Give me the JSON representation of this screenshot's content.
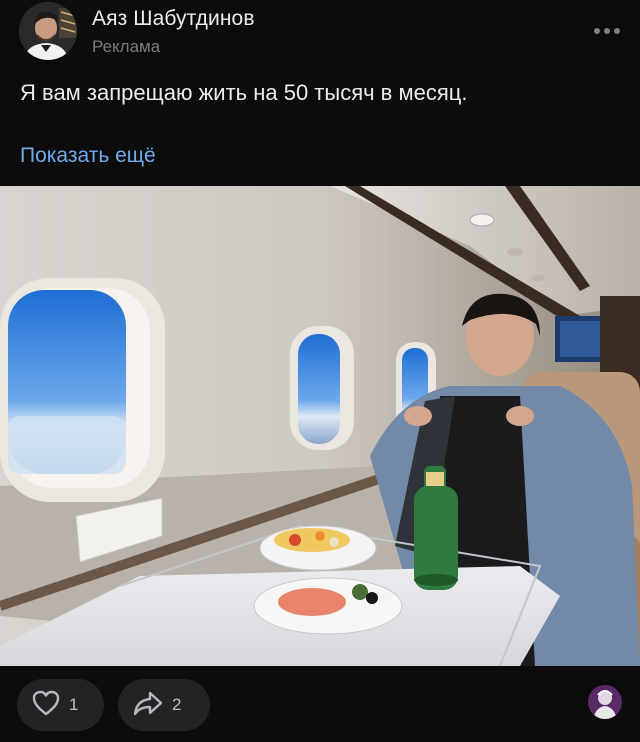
{
  "author": {
    "name": "Аяз Шабутдинов",
    "label": "Реклама"
  },
  "post": {
    "text": "Я вам запрещаю жить на 50 тысяч в месяц.",
    "show_more": "Показать ещё"
  },
  "actions": {
    "likes": "1",
    "shares": "2"
  },
  "icons": {
    "more": "more-dots-icon",
    "like": "heart-icon",
    "share": "share-arrow-icon"
  },
  "colors": {
    "background": "#0c0c0d",
    "link": "#71aaeb",
    "pill": "#232326",
    "muted": "#7c7c80"
  }
}
